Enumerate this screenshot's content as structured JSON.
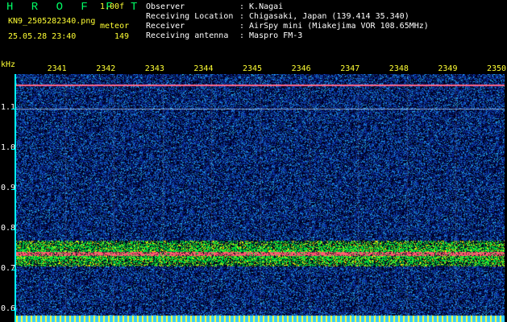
{
  "header": {
    "app_title": "H R O F F T",
    "version": "1.00f",
    "file_name": "KN9_2505282340.png",
    "meteor_label": "meteor",
    "timestamp": "25.05.28 23:40",
    "meteor_count": "149",
    "info": [
      {
        "label": "Observer",
        "value": ": K.Nagai"
      },
      {
        "label": "Receiving Location",
        "value": ": Chigasaki, Japan (139.414 35.340)"
      },
      {
        "label": "Receiver",
        "value": ": AirSpy mini (Miakejima VOR 108.65MHz)"
      },
      {
        "label": "Receiving antenna",
        "value": ": Maspro FM-3"
      }
    ]
  },
  "colors": {
    "background": "#000000",
    "header_text": "#ffff33",
    "title_text": "#00ff66",
    "info_text": "#ffffff",
    "axis_line": "#00ffff"
  },
  "chart_data": {
    "type": "heatmap",
    "title": "",
    "ylabel": "kHz",
    "xlabel": "",
    "x_tick_labels": [
      "2341",
      "2342",
      "2343",
      "2344",
      "2345",
      "2346",
      "2347",
      "2348",
      "2349",
      "2350"
    ],
    "x": [
      2341,
      2342,
      2343,
      2344,
      2345,
      2346,
      2347,
      2348,
      2349,
      2350
    ],
    "xlim": [
      2340,
      2350
    ],
    "y_ticks": [
      1.1,
      1.0,
      0.9,
      0.8,
      0.7,
      0.6
    ],
    "y_tick_labels": [
      "1.1",
      "1.0",
      "0.9",
      "0.8",
      "0.7",
      "0.6"
    ],
    "ylim": [
      0.57,
      1.185
    ],
    "horizontal_lines_khz": [
      1.16,
      1.1
    ],
    "signal_band_khz": 0.74,
    "grid": false
  }
}
